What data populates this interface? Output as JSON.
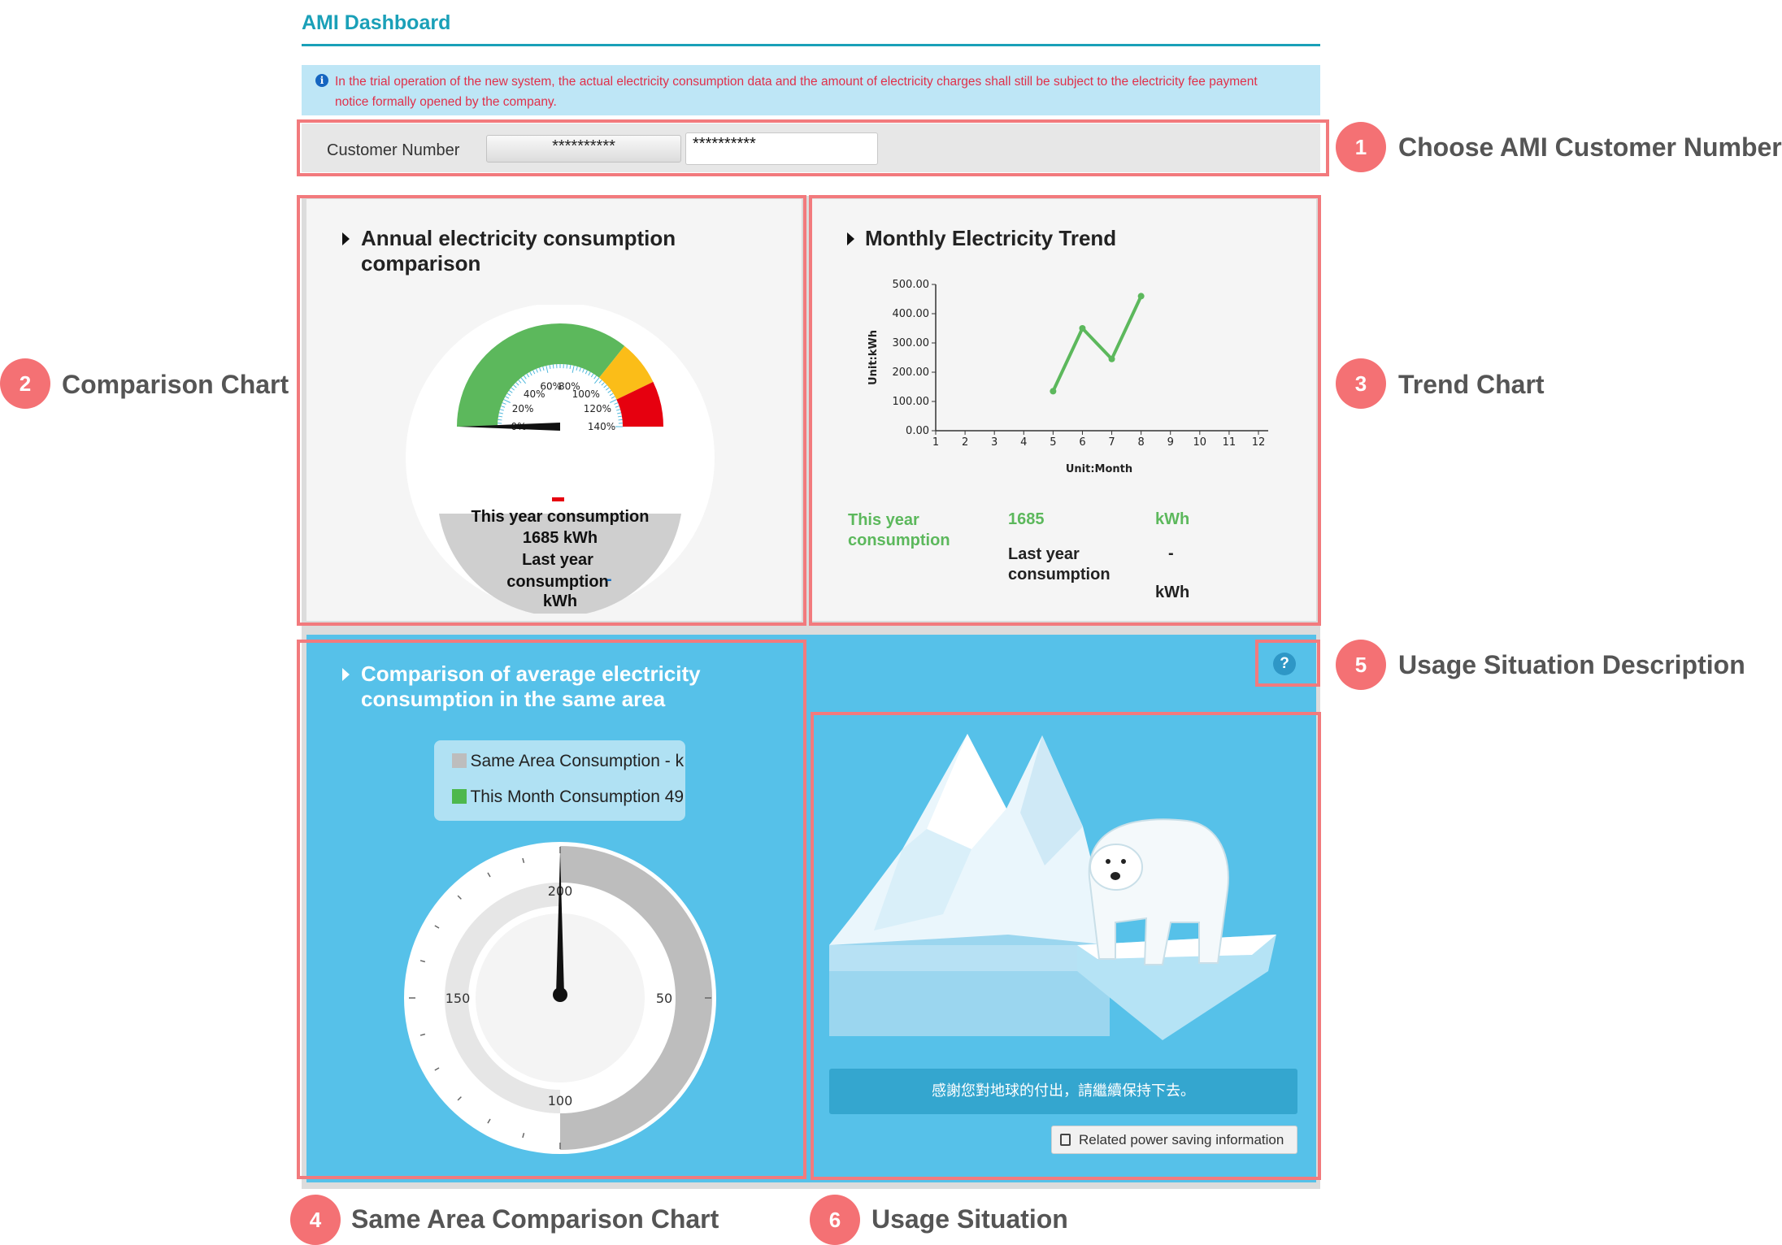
{
  "page": {
    "title": "AMI Dashboard"
  },
  "notice": {
    "text": "In the trial operation of the new system, the actual electricity consumption data and the amount of electricity charges shall still be subject to the electricity fee payment notice formally opened by the company."
  },
  "customer": {
    "label": "Customer Number",
    "selected": "**********",
    "value": "**********"
  },
  "annual": {
    "title": "Annual electricity consumption comparison",
    "gauge": {
      "ticks": [
        "0%",
        "20%",
        "40%",
        "60%",
        "80%",
        "100%",
        "120%",
        "140%"
      ],
      "bands": [
        {
          "from": 0,
          "to": 100,
          "color": "#5cb85c"
        },
        {
          "from": 100,
          "to": 120,
          "color": "#fbbd18"
        },
        {
          "from": 120,
          "to": 140,
          "color": "#e6000f"
        }
      ],
      "pointer_percent": 0
    },
    "this_year_label": "This year consumption",
    "this_year_value": "1685 kWh",
    "last_year_label": "Last year consumption",
    "last_year_dash": "-",
    "last_year_unit": "kWh"
  },
  "monthly": {
    "title": "Monthly Electricity Trend",
    "this_year_label": "This year consumption",
    "this_year_value": "1685",
    "this_year_unit": "kWh",
    "last_year_label": "Last year consumption",
    "last_year_value": "-",
    "last_year_unit": "kWh"
  },
  "chart_data": {
    "type": "line",
    "x": [
      5,
      6,
      7,
      8
    ],
    "y": [
      135,
      350,
      245,
      460
    ],
    "xticks": [
      "1",
      "2",
      "3",
      "4",
      "5",
      "6",
      "7",
      "8",
      "9",
      "10",
      "11",
      "12"
    ],
    "yticks": [
      "0.00",
      "100.00",
      "200.00",
      "300.00",
      "400.00",
      "500.00"
    ],
    "xlabel": "Unit:Month",
    "ylabel": "Unit:kWh",
    "xlim": [
      1,
      12
    ],
    "ylim": [
      0,
      500
    ],
    "color": "#5cb85c",
    "grid": false
  },
  "area": {
    "title": "Comparison of average electricity consumption in the same area",
    "legend": [
      {
        "label": "Same Area Consumption - k",
        "color": "#bdbdbd"
      },
      {
        "label": "This Month Consumption 49",
        "color": "#4db84d"
      }
    ],
    "dial": {
      "labels": [
        "200",
        "50",
        "100",
        "150"
      ],
      "pointer_label": "200"
    }
  },
  "usage": {
    "help": "?",
    "message": "感謝您對地球的付出，請繼續保持下去。",
    "link": "Related power saving information"
  },
  "callouts": [
    {
      "num": "1",
      "label": "Choose AMI Customer Number"
    },
    {
      "num": "2",
      "label": "Comparison Chart"
    },
    {
      "num": "3",
      "label": "Trend Chart"
    },
    {
      "num": "4",
      "label": "Same Area Comparison Chart"
    },
    {
      "num": "5",
      "label": "Usage Situation Description"
    },
    {
      "num": "6",
      "label": "Usage Situation"
    }
  ],
  "colors": {
    "accent": "#1aa0b8",
    "highlight": "#f27a7d",
    "panel_blue": "#56c1e9",
    "notice_bg": "#bee6f6",
    "notice_text": "#e0304a"
  }
}
